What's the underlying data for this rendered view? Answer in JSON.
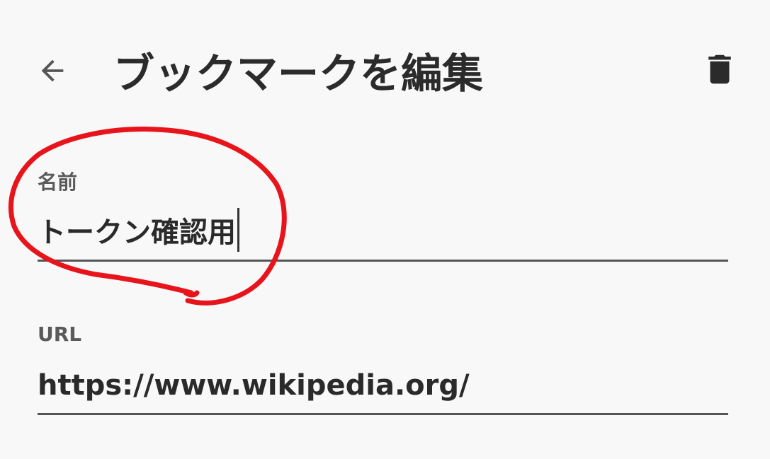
{
  "header": {
    "back_icon": "arrow-left-icon",
    "title": "ブックマークを編集",
    "delete_icon": "trash-icon"
  },
  "form": {
    "name": {
      "label": "名前",
      "value": "トークン確認用"
    },
    "url": {
      "label": "URL",
      "value": "https://www.wikipedia.org/"
    }
  },
  "colors": {
    "background": "#f8f8f8",
    "text": "#2b2b2b",
    "label": "#5a5a5a",
    "underline": "#555555",
    "annotation": "#e8141c"
  }
}
